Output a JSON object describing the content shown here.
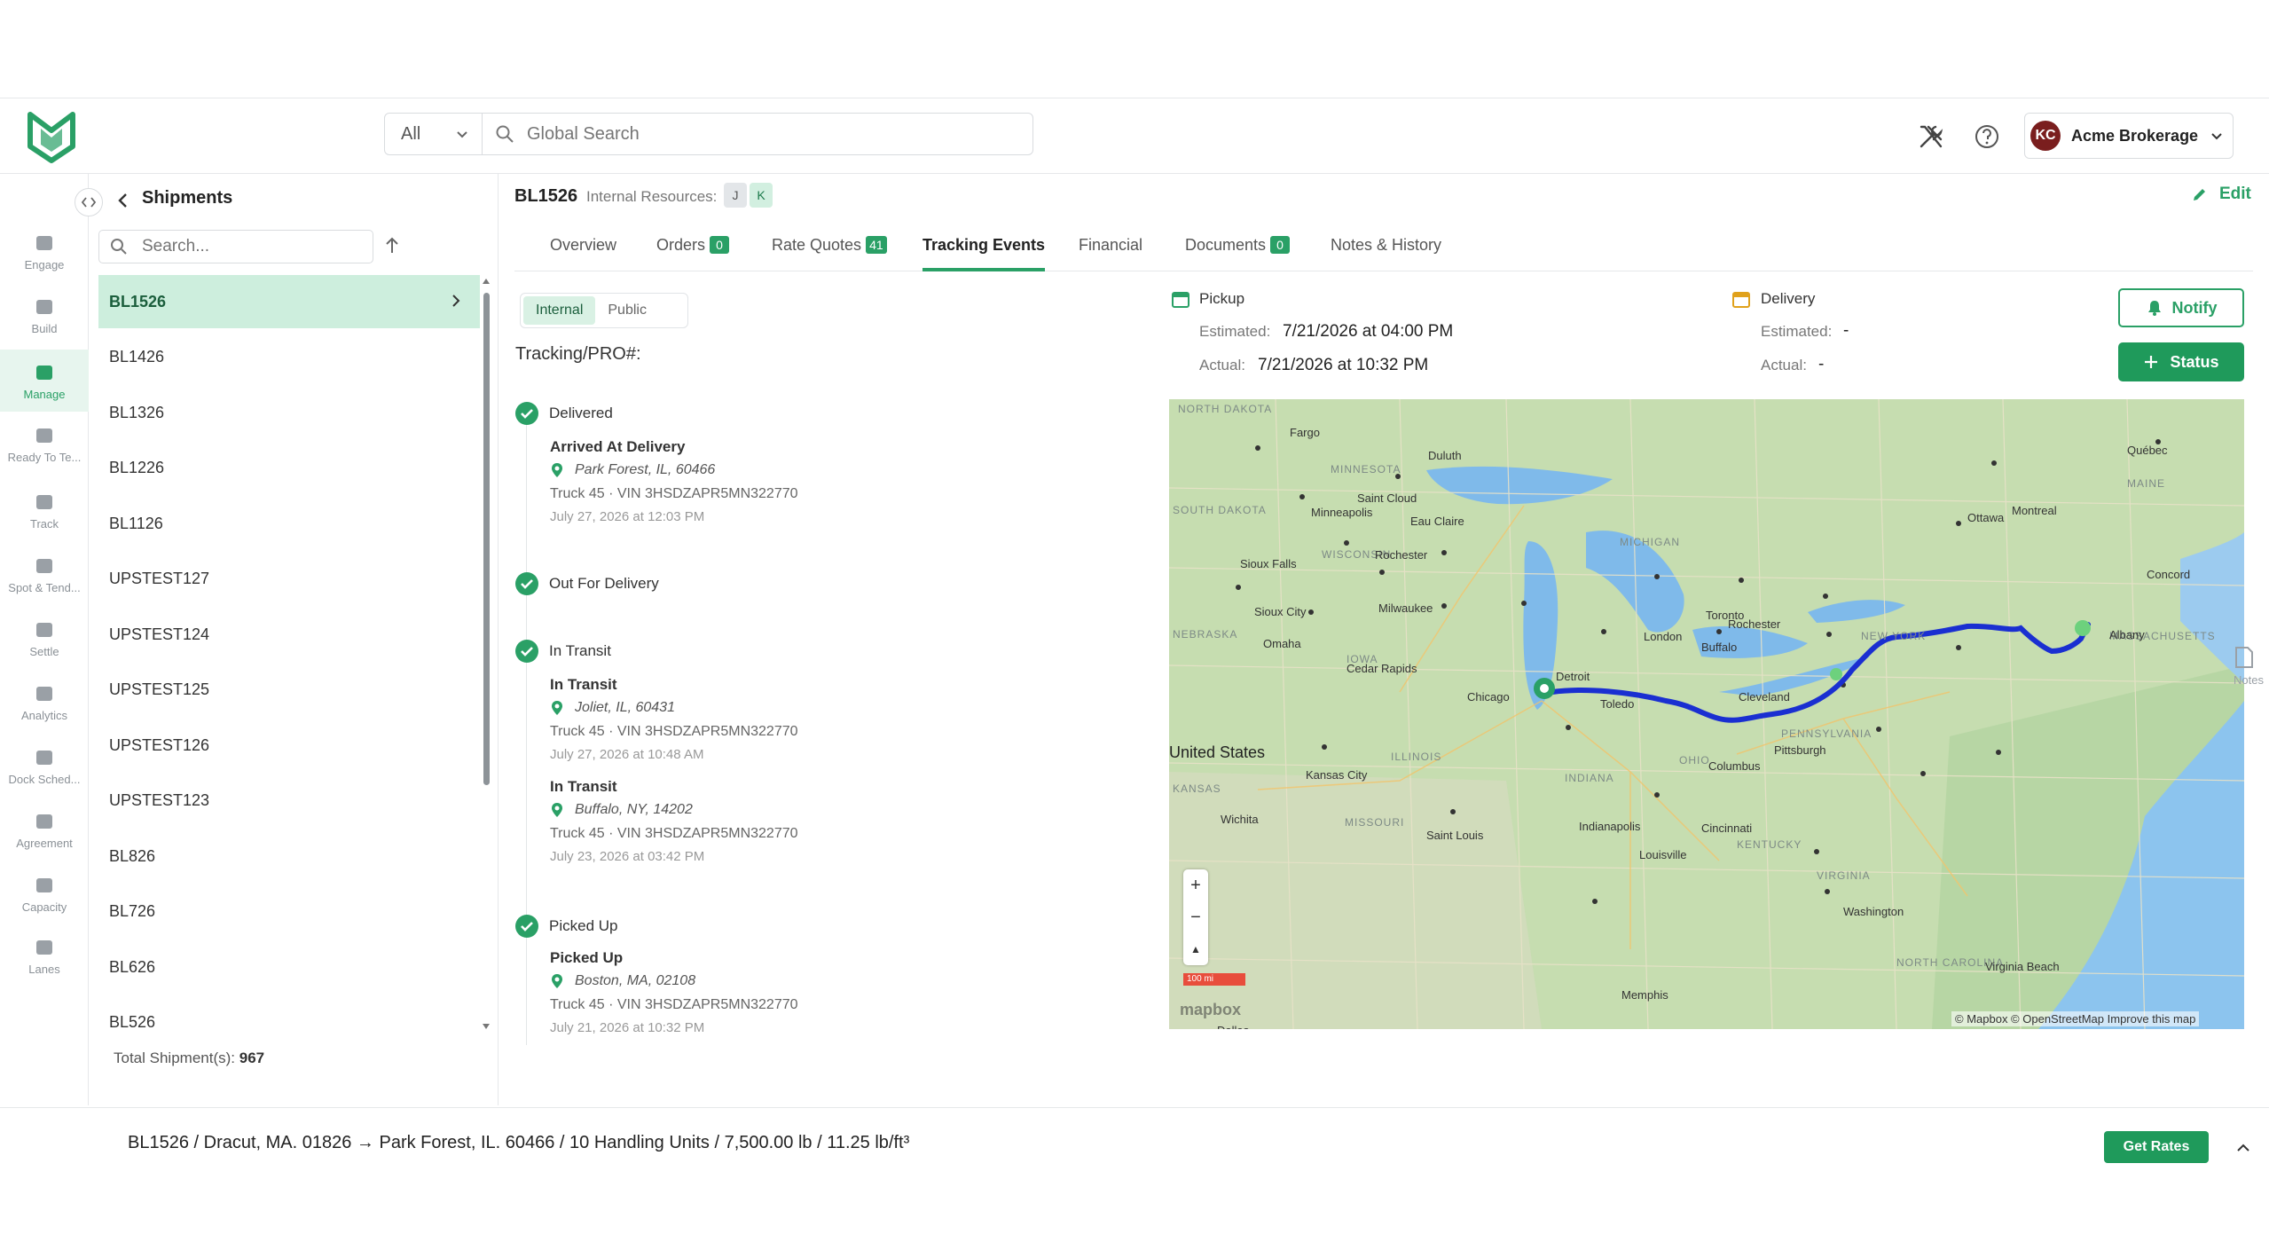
{
  "search": {
    "scope": "All",
    "placeholder": "Global Search"
  },
  "account": {
    "initials": "KC",
    "name": "Acme Brokerage"
  },
  "rail": {
    "items": [
      {
        "label": "Engage",
        "icon": "engage-icon"
      },
      {
        "label": "Build",
        "icon": "build-icon"
      },
      {
        "label": "Manage",
        "icon": "manage-icon"
      },
      {
        "label": "Ready To Te...",
        "icon": "ready-icon"
      },
      {
        "label": "Track",
        "icon": "track-icon"
      },
      {
        "label": "Spot & Tend...",
        "icon": "spot-icon"
      },
      {
        "label": "Settle",
        "icon": "settle-icon"
      },
      {
        "label": "Analytics",
        "icon": "analytics-icon"
      },
      {
        "label": "Dock Sched...",
        "icon": "dock-icon"
      },
      {
        "label": "Agreement",
        "icon": "agreement-icon"
      },
      {
        "label": "Capacity",
        "icon": "capacity-icon"
      },
      {
        "label": "Lanes",
        "icon": "lanes-icon"
      }
    ]
  },
  "list": {
    "title": "Shipments",
    "search_placeholder": "Search...",
    "items": [
      "BL1526",
      "BL1426",
      "BL1326",
      "BL1226",
      "BL1126",
      "UPSTEST127",
      "UPSTEST124",
      "UPSTEST125",
      "UPSTEST126",
      "UPSTEST123",
      "BL826",
      "BL726",
      "BL626",
      "BL526"
    ],
    "total_label": "Total Shipment(s):",
    "total_value": "967"
  },
  "detail": {
    "id": "BL1526",
    "resources_label": "Internal Resources:",
    "resources": [
      "J",
      "K"
    ],
    "edit_label": "Edit",
    "tabs": [
      {
        "label": "Overview",
        "badge": ""
      },
      {
        "label": "Orders",
        "badge": "0"
      },
      {
        "label": "Rate Quotes",
        "badge": "41"
      },
      {
        "label": "Tracking Events",
        "badge": ""
      },
      {
        "label": "Financial",
        "badge": ""
      },
      {
        "label": "Documents",
        "badge": "0"
      },
      {
        "label": "Notes & History",
        "badge": ""
      }
    ]
  },
  "tracking": {
    "toggle": [
      "Internal",
      "Public"
    ],
    "label": "Tracking/PRO#:",
    "groups": [
      {
        "status": "Delivered",
        "events": [
          {
            "title": "Arrived At Delivery",
            "location": "Park Forest, IL, 60466",
            "truck": "Truck 45 · VIN 3HSDZAPR5MN322770",
            "time": "July 27, 2026 at 12:03 PM"
          }
        ]
      },
      {
        "status": "Out For Delivery",
        "events": []
      },
      {
        "status": "In Transit",
        "events": [
          {
            "title": "In Transit",
            "location": "Joliet, IL, 60431",
            "truck": "Truck 45 · VIN 3HSDZAPR5MN322770",
            "time": "July 27, 2026 at 10:48 AM"
          },
          {
            "title": "In Transit",
            "location": "Buffalo, NY, 14202",
            "truck": "Truck 45 · VIN 3HSDZAPR5MN322770",
            "time": "July 23, 2026 at 03:42 PM"
          }
        ]
      },
      {
        "status": "Picked Up",
        "events": [
          {
            "title": "Picked Up",
            "location": "Boston, MA, 02108",
            "truck": "Truck 45 · VIN 3HSDZAPR5MN322770",
            "time": "July 21, 2026 at 10:32 PM"
          }
        ]
      }
    ]
  },
  "pickup": {
    "title": "Pickup",
    "estimated_label": "Estimated:",
    "estimated": "7/21/2026 at 04:00 PM",
    "actual_label": "Actual:",
    "actual": "7/21/2026 at 10:32 PM"
  },
  "delivery": {
    "title": "Delivery",
    "estimated_label": "Estimated:",
    "estimated": "-",
    "actual_label": "Actual:",
    "actual": "-"
  },
  "actions": {
    "notify": "Notify",
    "status": "Status"
  },
  "map": {
    "states": [
      "NORTH DAKOTA",
      "MINNESOTA",
      "SOUTH DAKOTA",
      "WISCONSIN",
      "MICHIGAN",
      "IOWA",
      "ILLINOIS",
      "INDIANA",
      "OHIO",
      "PENNSYLVANIA",
      "NEW YORK",
      "KANSAS",
      "MISSOURI",
      "KENTUCKY",
      "VIRGINIA",
      "NORTH CAROLINA",
      "MAINE",
      "MASSACHUSETTS",
      "NEBRASKA"
    ],
    "cities": [
      "Fargo",
      "Duluth",
      "Saint Cloud",
      "Minneapolis",
      "Eau Claire",
      "Rochester",
      "Sioux Falls",
      "Sioux City",
      "Omaha",
      "Milwaukee",
      "Cedar Rapids",
      "Chicago",
      "Toledo",
      "Detroit",
      "London",
      "Toronto",
      "Rochester",
      "Buffalo",
      "Cleveland",
      "Pittsburgh",
      "Ottawa",
      "Montreal",
      "Québec",
      "Concord",
      "Albany",
      "Kansas City",
      "Wichita",
      "Saint Louis",
      "Indianapolis",
      "Cincinnati",
      "Louisville",
      "Columbus",
      "Washington",
      "Virginia Beach",
      "Memphis",
      "Dallas"
    ],
    "country": "United States",
    "scale": "100 mi",
    "logo": "mapbox",
    "attribution": "© Mapbox © OpenStreetMap  Improve this map",
    "zoom_in": "+",
    "zoom_out": "−",
    "north": "▲"
  },
  "notes_side": "Notes",
  "footer": {
    "summary": "BL1526 / Dracut, MA. 01826 → Park Forest, IL. 60466 / 10 Handling Units / 7,500.00 lb / 11.25 lb/ft³",
    "get_rates": "Get Rates"
  },
  "colors": {
    "accent": "#2aa066",
    "route": "#1a2fd1",
    "avatar": "#7a1e1e"
  }
}
